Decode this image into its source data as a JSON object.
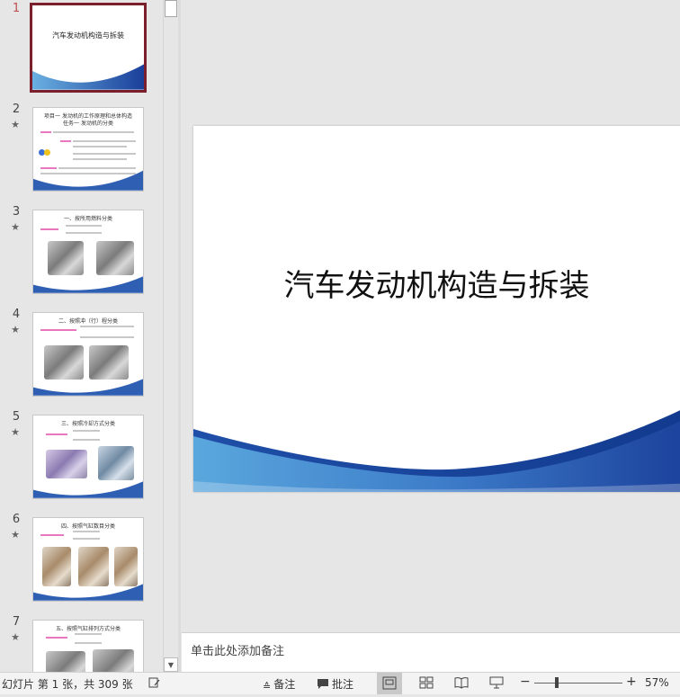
{
  "thumbnails": [
    {
      "number": "1",
      "star": "",
      "title": "汽车发动机构造与拆装",
      "selected": true
    },
    {
      "number": "2",
      "star": "★",
      "head": "项目一 发动机的工作原理和总体构造\n任务一 发动机的分类",
      "selected": false
    },
    {
      "number": "3",
      "star": "★",
      "head": "一、按所用燃料分类",
      "selected": false
    },
    {
      "number": "4",
      "star": "★",
      "head": "二、按照冲（行）程分类",
      "selected": false
    },
    {
      "number": "5",
      "star": "★",
      "head": "三、按照冷却方式分类",
      "selected": false
    },
    {
      "number": "6",
      "star": "★",
      "head": "四、按照气缸数目分类",
      "selected": false
    },
    {
      "number": "7",
      "star": "★",
      "head": "五、按照气缸排列方式分类",
      "selected": false
    }
  ],
  "slide": {
    "title": "汽车发动机构造与拆装"
  },
  "notes": {
    "placeholder": "单击此处添加备注"
  },
  "status": {
    "slide_info": "幻灯片 第 1 张，共 309 张",
    "notes_label": "备注",
    "comments_label": "批注",
    "zoom_minus": "−",
    "zoom_plus": "+",
    "zoom_level": "57%"
  },
  "colors": {
    "accent_dark": "#1a3f9a",
    "accent_light": "#5aa7dd",
    "selected_border": "#7a1f2b",
    "active_number": "#c0504d"
  }
}
